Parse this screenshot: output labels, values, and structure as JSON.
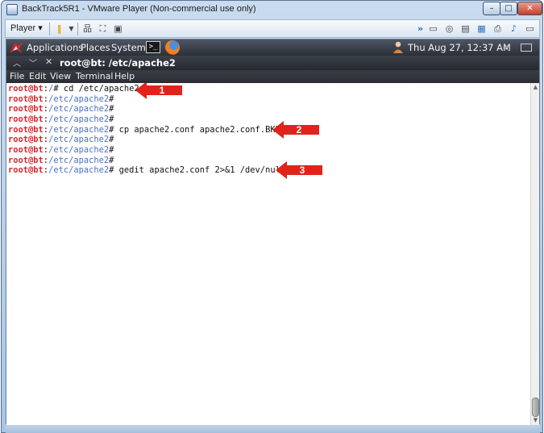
{
  "vm_window": {
    "title": "BackTrack5R1 - VMware Player (Non-commercial use only)",
    "controls": {
      "minimize": "–",
      "maximize": "□",
      "close": "✕"
    }
  },
  "vm_toolbar": {
    "player_label": "Player ▾",
    "icons": [
      "pause-icon",
      "dropdown-icon",
      "network-icon",
      "fullscreen-icon",
      "unity-icon",
      "forward-icon",
      "usb-icon",
      "cd-icon",
      "hdd-icon",
      "printer-icon",
      "sound-icon",
      "display-icon"
    ]
  },
  "gnome_panel": {
    "menus": [
      "Applications",
      "Places",
      "System"
    ],
    "clock": "Thu Aug 27, 12:37 AM"
  },
  "terminal": {
    "title": "root@bt: /etc/apache2",
    "menus": [
      "File",
      "Edit",
      "View",
      "Terminal",
      "Help"
    ],
    "lines": [
      {
        "user": "root@bt",
        "sep": ":",
        "path": "/",
        "cmd": "# cd /etc/apache2"
      },
      {
        "user": "root@bt",
        "sep": ":",
        "path": "/etc/apache2",
        "cmd": "#"
      },
      {
        "user": "root@bt",
        "sep": ":",
        "path": "/etc/apache2",
        "cmd": "#"
      },
      {
        "user": "root@bt",
        "sep": ":",
        "path": "/etc/apache2",
        "cmd": "#"
      },
      {
        "user": "root@bt",
        "sep": ":",
        "path": "/etc/apache2",
        "cmd": "# cp apache2.conf apache2.conf.BKP"
      },
      {
        "user": "root@bt",
        "sep": ":",
        "path": "/etc/apache2",
        "cmd": "#"
      },
      {
        "user": "root@bt",
        "sep": ":",
        "path": "/etc/apache2",
        "cmd": "#"
      },
      {
        "user": "root@bt",
        "sep": ":",
        "path": "/etc/apache2",
        "cmd": "#"
      },
      {
        "user": "root@bt",
        "sep": ":",
        "path": "/etc/apache2",
        "cmd": "# gedit apache2.conf 2>&1 /dev/null"
      }
    ]
  },
  "annotations": [
    {
      "label": "1"
    },
    {
      "label": "2"
    },
    {
      "label": "3"
    }
  ],
  "colors": {
    "arrow_red": "#e0231b",
    "prompt_user": "#d8262b",
    "prompt_path": "#4b71c1"
  }
}
